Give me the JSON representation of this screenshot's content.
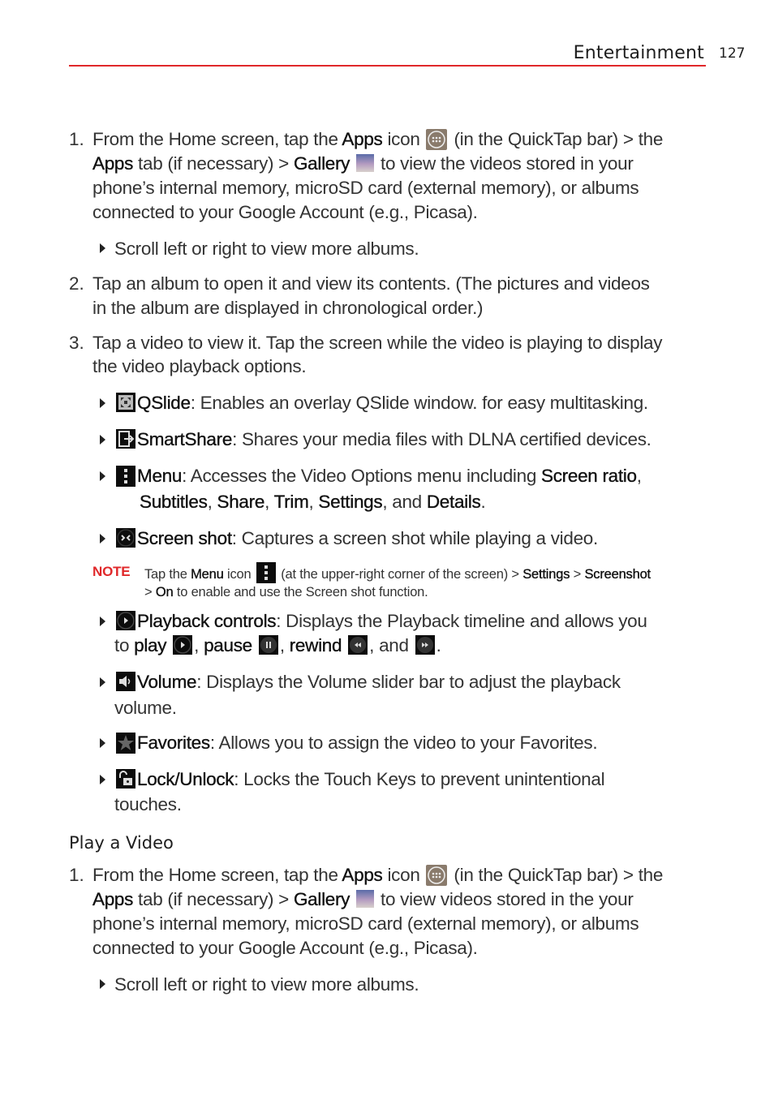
{
  "header": {
    "section_title": "Entertainment",
    "page_number": "127",
    "accent_color": "#e0282a"
  },
  "steps_gallery": [
    {
      "number": "1.",
      "lines": [
        [
          "From the Home screen, tap the ",
          "Apps",
          " icon ",
          "(in the QuickTap bar) > the"
        ],
        [
          "Apps",
          " tab (if necessary) > ",
          "Gallery",
          " to view the videos stored in your"
        ],
        [
          "phone’s internal memory, microSD card (external memory), or albums"
        ],
        [
          "connected to your Google Account (e.g., Picasa)."
        ]
      ],
      "bullet": "Scroll left or right to view more albums."
    },
    {
      "number": "2.",
      "lines": [
        "Tap an album to open it and view its contents. (The pictures and videos",
        "in the album are displayed in chronological order.)"
      ]
    },
    {
      "number": "3.",
      "lines": [
        "Tap a video to view it. Tap the screen while the video is playing to display",
        "the video playback options."
      ]
    }
  ],
  "options": [
    {
      "icon": "qslide-icon",
      "term": "QSlide",
      "desc": ": Enables an overlay QSlide window. for easy multitasking."
    },
    {
      "icon": "smartshare-icon",
      "term": "SmartShare",
      "desc": ": Shares your media files with DLNA certified devices."
    },
    {
      "icon": "menu-icon",
      "term": "Menu",
      "desc": ": Accesses the Video Options menu including ",
      "items": [
        "Screen ratio",
        "Subtitles",
        "Share",
        "Trim",
        "Settings",
        "Details"
      ],
      "and": ", and "
    },
    {
      "icon": "screenshot-icon",
      "term": "Screen shot",
      "desc": ": Captures a screen shot while playing a video."
    },
    {
      "icon": "play-icon",
      "term": "Playback controls",
      "desc": ": Displays the Playback timeline and allows you",
      "line2": {
        "to": "to ",
        "play": "play",
        "pause": "pause",
        "rewind": "rewind",
        "and": "and",
        "end": "."
      }
    },
    {
      "icon": "volume-icon",
      "term": "Volume",
      "desc": ": Displays the Volume slider bar to adjust the playback",
      "cont": "volume."
    },
    {
      "icon": "star-icon",
      "term": "Favorites",
      "desc": ": Allows you to assign the video to your Favorites."
    },
    {
      "icon": "unlock-icon",
      "term": "Lock/Unlock",
      "desc": ": Locks the Touch Keys to prevent unintentional",
      "cont": "touches."
    }
  ],
  "note": {
    "label": "NOTE",
    "p1": "Tap the ",
    "menu": "Menu",
    "p2": " icon ",
    "p3": " (at the upper-right corner of the screen) > ",
    "settings": "Settings",
    "gt": " > ",
    "screenshot": "Screenshot",
    "line2_gt": "> ",
    "on": "On",
    "line2_rest": " to enable and use the Screen shot function."
  },
  "play_video": {
    "heading": "Play a Video",
    "number": "1.",
    "l1a": "From the Home screen, tap the ",
    "apps": "Apps",
    "l1b": " icon ",
    "l1c": " (in the QuickTap bar) > the",
    "l2a": " tab (if necessary) > ",
    "gallery": "Gallery",
    "l2b": " to view videos stored in the your",
    "l3": "phone’s internal memory, microSD card (external memory), or albums",
    "l4": "connected to your Google Account (e.g., Picasa).",
    "bullet": "Scroll left or right to view more albums."
  }
}
